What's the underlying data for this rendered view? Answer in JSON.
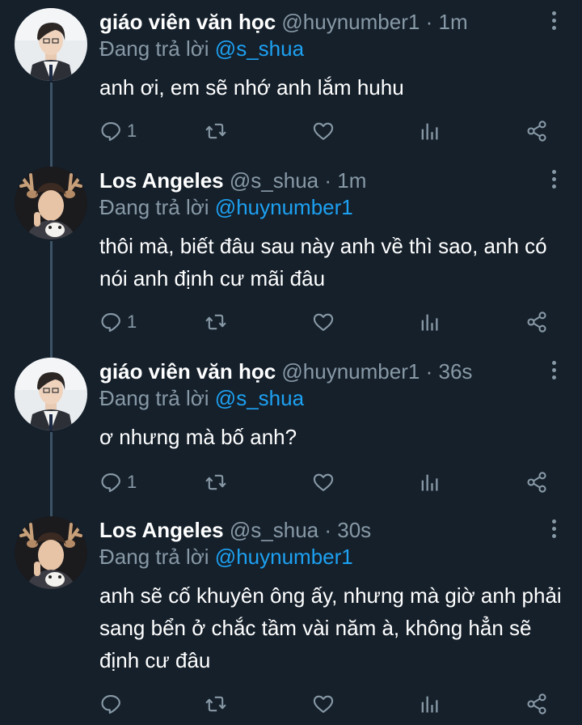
{
  "tweets": [
    {
      "name": "giáo viên văn học",
      "handle": "@huynumber1",
      "dot": "·",
      "time": "1m",
      "reply_prefix": "Đang trả lời",
      "reply_to": "@s_shua",
      "text": "anh ơi, em sẽ nhớ anh lắm huhu",
      "reply_count": "1",
      "avatar": "boy-uniform-avatar"
    },
    {
      "name": "Los Angeles",
      "handle": "@s_shua",
      "dot": "·",
      "time": "1m",
      "reply_prefix": "Đang trả lời",
      "reply_to": "@huynumber1",
      "text": "thôi mà, biết đâu sau này anh về thì sao, anh có nói anh định cư mãi đâu",
      "reply_count": "1",
      "avatar": "reindeer-antlers-avatar"
    },
    {
      "name": "giáo viên văn học",
      "handle": "@huynumber1",
      "dot": "·",
      "time": "36s",
      "reply_prefix": "Đang trả lời",
      "reply_to": "@s_shua",
      "text": "ơ nhưng mà bố anh?",
      "reply_count": "1",
      "avatar": "boy-uniform-avatar"
    },
    {
      "name": "Los Angeles",
      "handle": "@s_shua",
      "dot": "·",
      "time": "30s",
      "reply_prefix": "Đang trả lời",
      "reply_to": "@huynumber1",
      "text": "anh sẽ cố khuyên ông ấy, nhưng mà giờ anh phải sang bển ở chắc tầm vài năm à, không hẳn sẽ định cư đâu",
      "reply_count": "",
      "avatar": "reindeer-antlers-avatar"
    }
  ],
  "icons": {
    "reply": "reply-icon",
    "retweet": "retweet-icon",
    "like": "heart-icon",
    "stats": "analytics-icon",
    "share": "share-icon",
    "more": "more-vertical-icon"
  },
  "colors": {
    "background": "#15202b",
    "muted": "#8899a6",
    "mention": "#1da1f2",
    "thread_line": "#3d5466"
  }
}
